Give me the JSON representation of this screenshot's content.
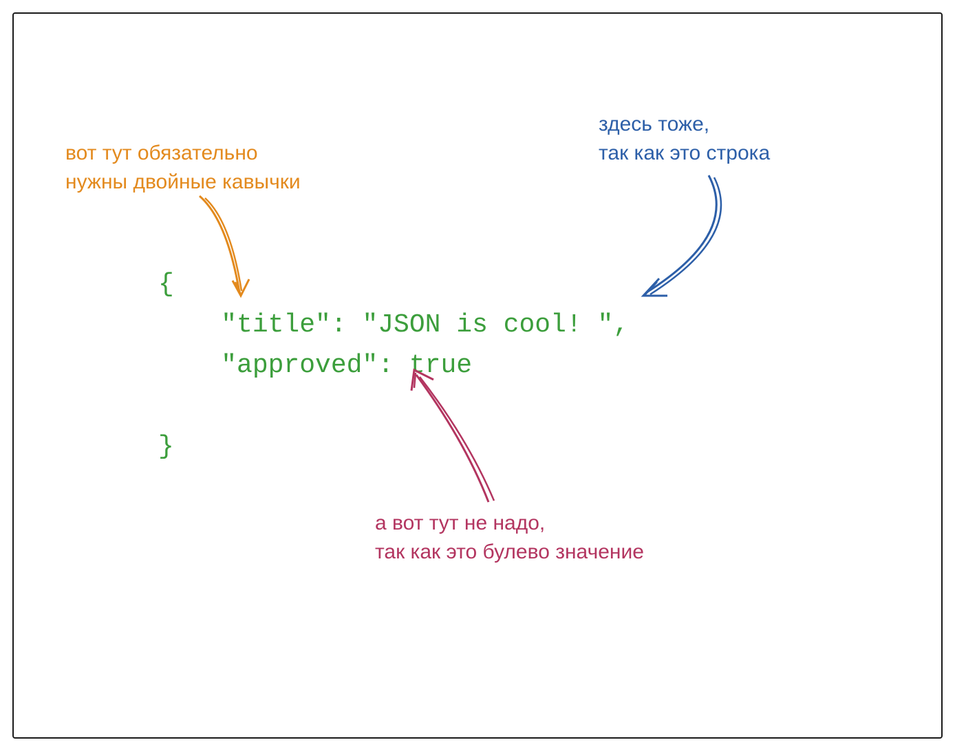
{
  "code": {
    "open_brace": "{",
    "line1": "    \"title\": \"JSON is cool! \",",
    "line2": "    \"approved\": true",
    "blank": "",
    "close_brace": "}"
  },
  "annotations": {
    "orange": {
      "line1": "вот тут обязательно",
      "line2": "нужны двойные кавычки"
    },
    "blue": {
      "line1": "здесь тоже,",
      "line2": "так как это строка"
    },
    "crimson": {
      "line1": "а вот тут не надо,",
      "line2": "так как это булево значение"
    }
  },
  "colors": {
    "code_green": "#3c9e3c",
    "annotation_orange": "#e38a1e",
    "annotation_blue": "#2d5fa8",
    "annotation_crimson": "#b33560"
  }
}
